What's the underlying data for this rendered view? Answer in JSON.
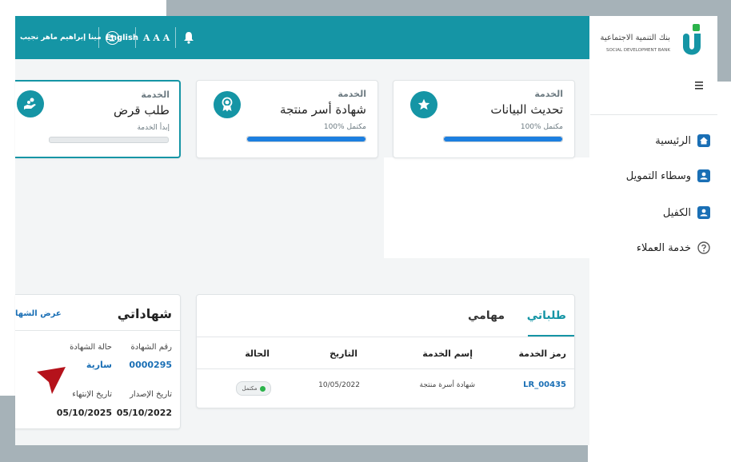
{
  "topbar": {
    "user_name": "مينا إبراهيم ماهر نجيب",
    "language": "English",
    "font_size_label": "A A A"
  },
  "brand": {
    "name_ar": "بنك التنمية الاجتماعية",
    "name_en": "SOCIAL DEVELOPMENT BANK"
  },
  "sidebar": {
    "menu_icon": "hamburger-icon",
    "items": [
      {
        "label": "الرئيسية",
        "icon": "home-icon"
      },
      {
        "label": "وسطاء التمويل",
        "icon": "user-badge-icon"
      },
      {
        "label": "الكفيل",
        "icon": "user-badge-icon"
      },
      {
        "label": "خدمة العملاء",
        "icon": "help-icon"
      }
    ]
  },
  "services": [
    {
      "label": "الخدمة",
      "name": "تحديث البيانات",
      "status": "مكتمل %100",
      "progress": 1.0,
      "icon": "star-icon"
    },
    {
      "label": "الخدمة",
      "name": "شهادة أسر منتجة",
      "status": "مكتمل %100",
      "progress": 1.0,
      "icon": "award-icon"
    },
    {
      "label": "الخدمة",
      "name": "طلب قرض",
      "status": "إبدأ الخدمة",
      "progress": 0.0,
      "icon": "loan-hand-icon"
    }
  ],
  "requests": {
    "tab_requests": "طلباتي",
    "tab_tasks": "مهامي",
    "columns": [
      "رمز الخدمة",
      "إسم الخدمة",
      "التاريخ",
      "الحالة"
    ],
    "rows": [
      {
        "code": "LR_00435",
        "name": "شهادة أسرة منتجة",
        "date": "10/05/2022",
        "status": "مكتمل"
      }
    ]
  },
  "certificates": {
    "title": "شهاداتي",
    "view_link": "عرض الشها",
    "cert_number_label": "رقم الشهادة",
    "cert_number": "0000295",
    "cert_status_label": "حالة الشهادة",
    "cert_status": "سارية",
    "issue_date_label": "تاريخ الإصدار",
    "issue_date": "05/10/2022",
    "expiry_date_label": "تاريخ الإنتهاء",
    "expiry_date": "05/10/2025"
  },
  "colors": {
    "teal": "#1595a5",
    "progress_blue": "#1c7fe0",
    "link_blue": "#1a6fb5",
    "status_green": "#2bb34a",
    "grey_frame": "#a6b2b8",
    "pointer_red": "#b5121b"
  }
}
